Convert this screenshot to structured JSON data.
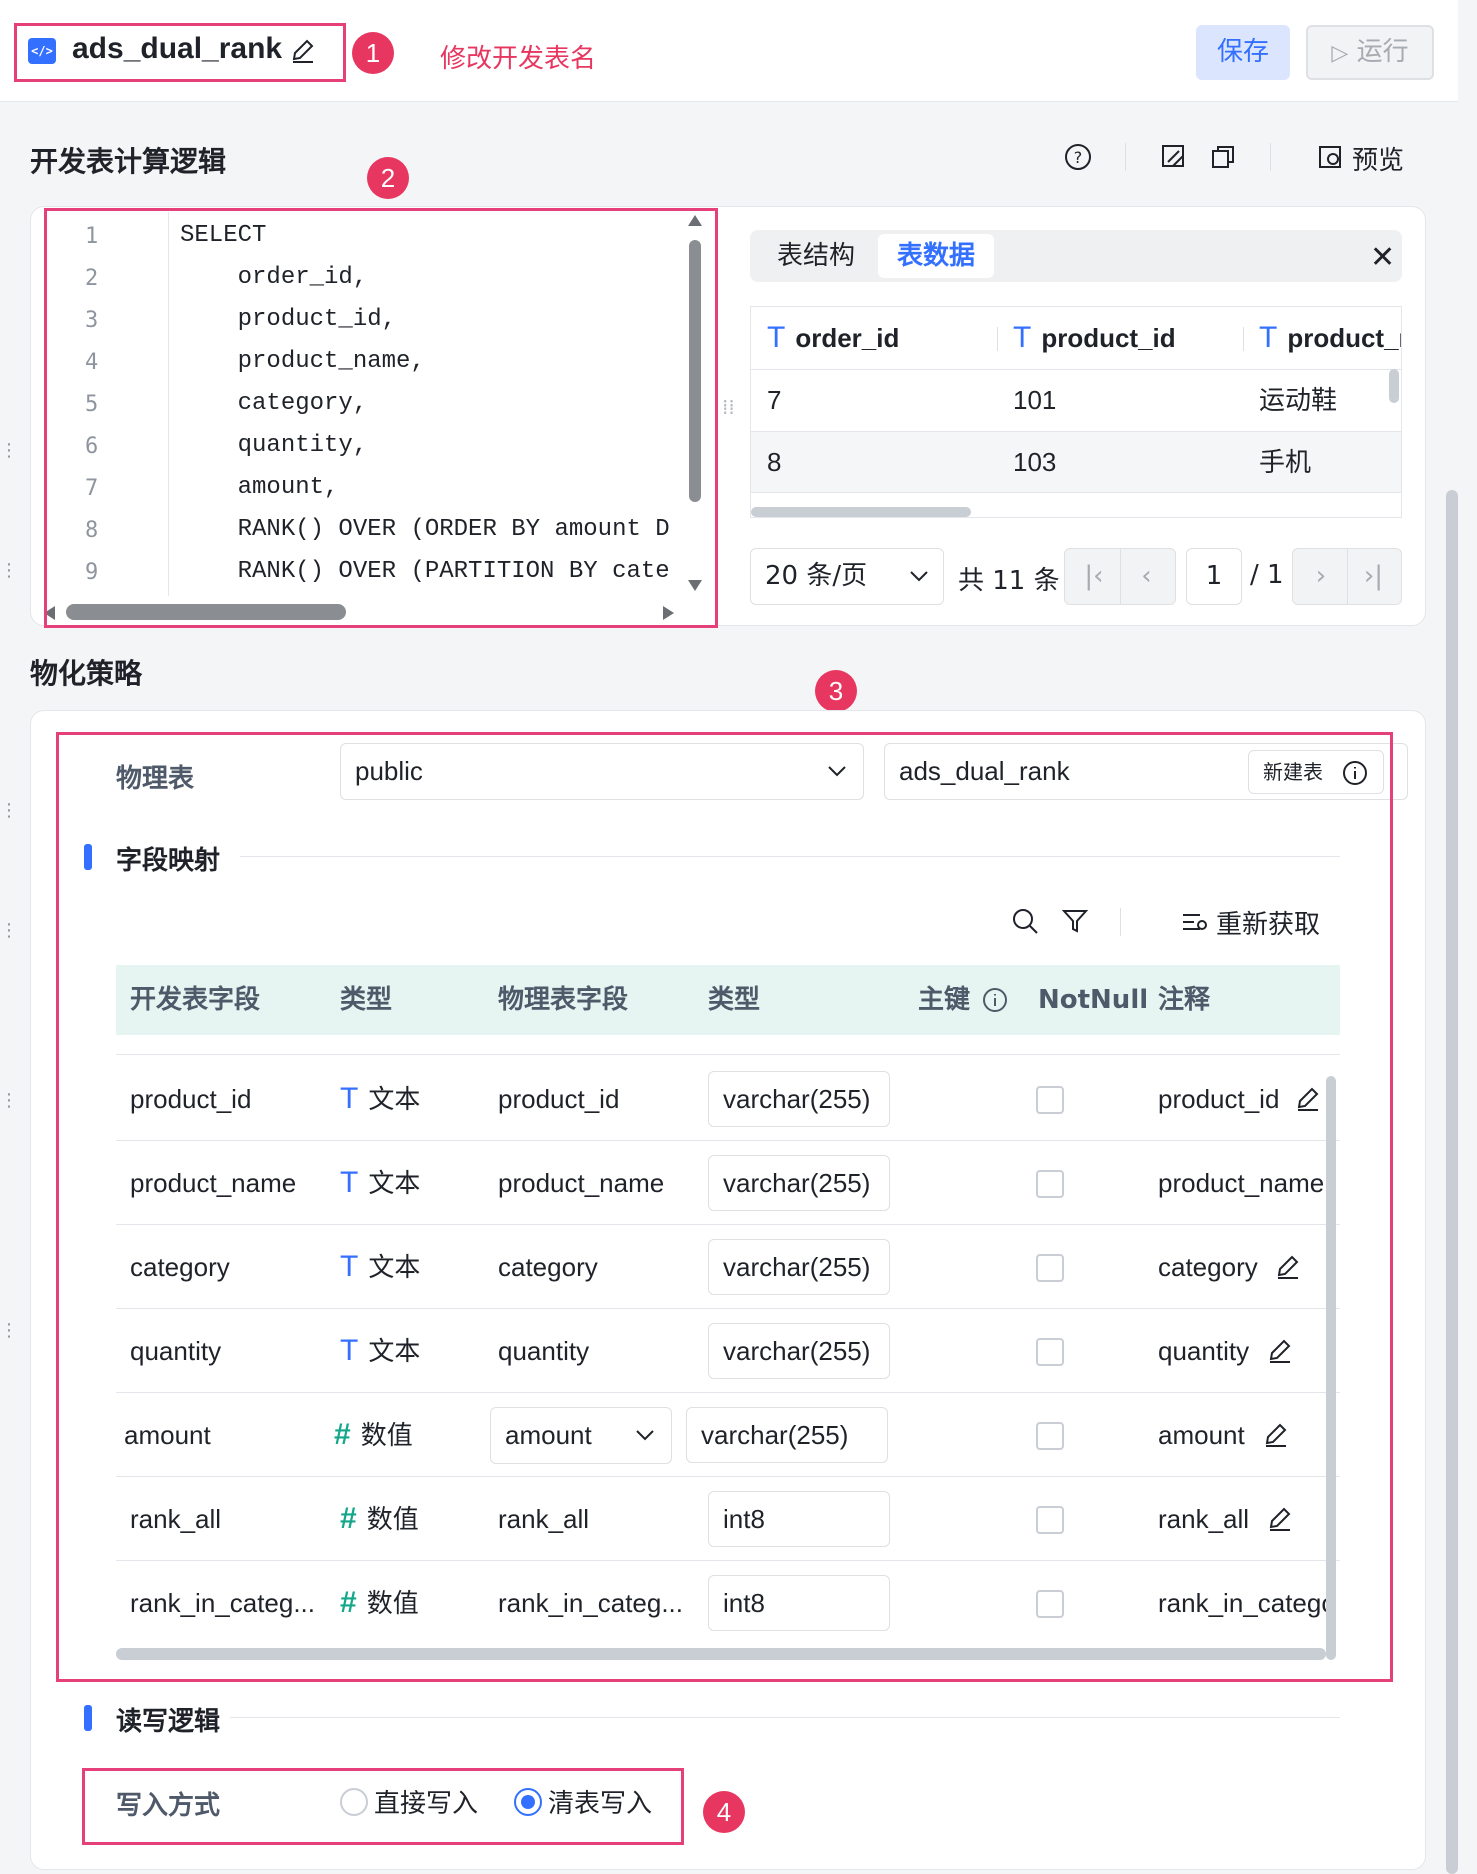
{
  "header": {
    "table_name": "ads_dual_rank",
    "file_icon": "</>",
    "annotation": "修改开发表名",
    "save_label": "保存",
    "run_label": "运行",
    "badges": [
      "1",
      "2",
      "3",
      "4"
    ]
  },
  "logic": {
    "title": "开发表计算逻辑",
    "preview_label": "预览",
    "icons": [
      "help-icon",
      "format-icon",
      "copy-icon",
      "preview-icon"
    ],
    "code_lines": [
      {
        "n": "1",
        "text": "SELECT"
      },
      {
        "n": "2",
        "text": "    order_id,"
      },
      {
        "n": "3",
        "text": "    product_id,"
      },
      {
        "n": "4",
        "text": "    product_name,"
      },
      {
        "n": "5",
        "text": "    category,"
      },
      {
        "n": "6",
        "text": "    quantity,"
      },
      {
        "n": "7",
        "text": "    amount,"
      },
      {
        "n": "8",
        "text": "    RANK() OVER (ORDER BY amount D"
      },
      {
        "n": "9",
        "text": "    RANK() OVER (PARTITION BY cate"
      }
    ]
  },
  "preview": {
    "tabs": [
      "表结构",
      "表数据"
    ],
    "active_tab": "表数据",
    "columns": [
      "order_id",
      "product_id",
      "product_r"
    ],
    "column_type_glyph": "T",
    "rows": [
      [
        "7",
        "101",
        "运动鞋"
      ],
      [
        "8",
        "103",
        "手机"
      ]
    ],
    "page_size": "20 条/页",
    "total": "共 11 条",
    "current_page": "1",
    "page_total": "/ 1"
  },
  "materialize": {
    "title": "物化策略",
    "physical_table_label": "物理表",
    "schema": "public",
    "physical_table_name": "ads_dual_rank",
    "new_table_label": "新建表",
    "field_mapping_title": "字段映射",
    "refetch_label": "重新获取",
    "headers": [
      "开发表字段",
      "类型",
      "物理表字段",
      "类型",
      "主键",
      "NotNull",
      "注释"
    ],
    "rows": [
      {
        "dev_field": "product_id",
        "type_glyph": "T",
        "type_label": "文本",
        "phys_field": "product_id",
        "phys_type": "varchar(255)",
        "comment": "product_id"
      },
      {
        "dev_field": "product_name",
        "type_glyph": "T",
        "type_label": "文本",
        "phys_field": "product_name",
        "phys_type": "varchar(255)",
        "comment": "product_name"
      },
      {
        "dev_field": "category",
        "type_glyph": "T",
        "type_label": "文本",
        "phys_field": "category",
        "phys_type": "varchar(255)",
        "comment": "category"
      },
      {
        "dev_field": "quantity",
        "type_glyph": "T",
        "type_label": "文本",
        "phys_field": "quantity",
        "phys_type": "varchar(255)",
        "comment": "quantity"
      },
      {
        "dev_field": "amount",
        "type_glyph": "#",
        "type_label": "数值",
        "phys_field": "amount",
        "phys_type": "varchar(255)",
        "comment": "amount"
      },
      {
        "dev_field": "rank_all",
        "type_glyph": "#",
        "type_label": "数值",
        "phys_field": "rank_all",
        "phys_type": "int8",
        "comment": "rank_all"
      },
      {
        "dev_field": "rank_in_categ...",
        "type_glyph": "#",
        "type_label": "数值",
        "phys_field": "rank_in_categ...",
        "phys_type": "int8",
        "comment": "rank_in_category"
      }
    ],
    "rw_title": "读写逻辑",
    "write_mode_label": "写入方式",
    "write_options": [
      "直接写入",
      "清表写入"
    ],
    "selected_write_option": "清表写入"
  }
}
